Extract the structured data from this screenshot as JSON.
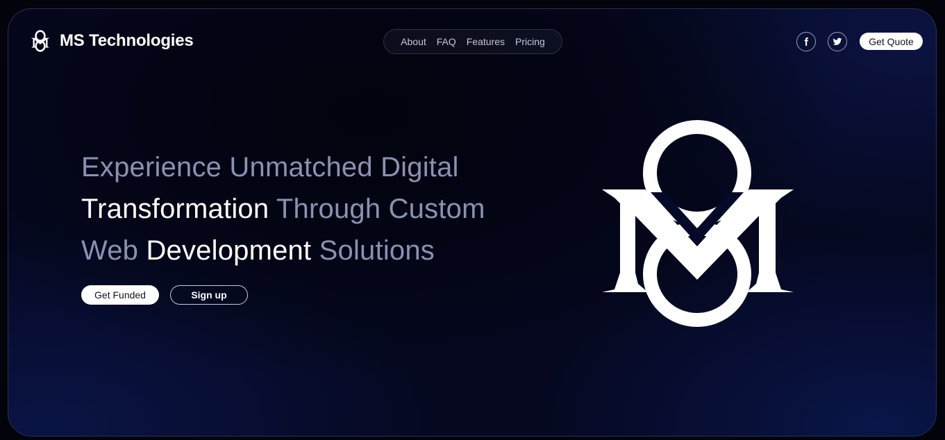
{
  "brand": {
    "name": "MS Technologies",
    "logo_icon": "ms-monogram-icon"
  },
  "nav": {
    "items": [
      {
        "label": "About"
      },
      {
        "label": "FAQ"
      },
      {
        "label": "Features"
      },
      {
        "label": "Pricing"
      }
    ]
  },
  "header": {
    "social": [
      {
        "icon": "facebook-icon",
        "glyph": "f"
      },
      {
        "icon": "twitter-icon"
      }
    ],
    "cta_label": "Get Quote"
  },
  "hero": {
    "line1": {
      "dim": "Experience Unmatched Digital"
    },
    "line2": {
      "bright": "Transformation",
      "dim": " Through Custom"
    },
    "line3": {
      "dim_a": "Web ",
      "bright": "Development",
      "dim_b": " Solutions"
    },
    "primary_button": "Get Funded",
    "secondary_button": "Sign up",
    "art_icon": "ms-monogram-large-icon"
  },
  "colors": {
    "background": "#050820",
    "headline_dim": "#8b91b3",
    "headline_bright": "#ffffff",
    "nav_text": "#c3c7d6"
  }
}
